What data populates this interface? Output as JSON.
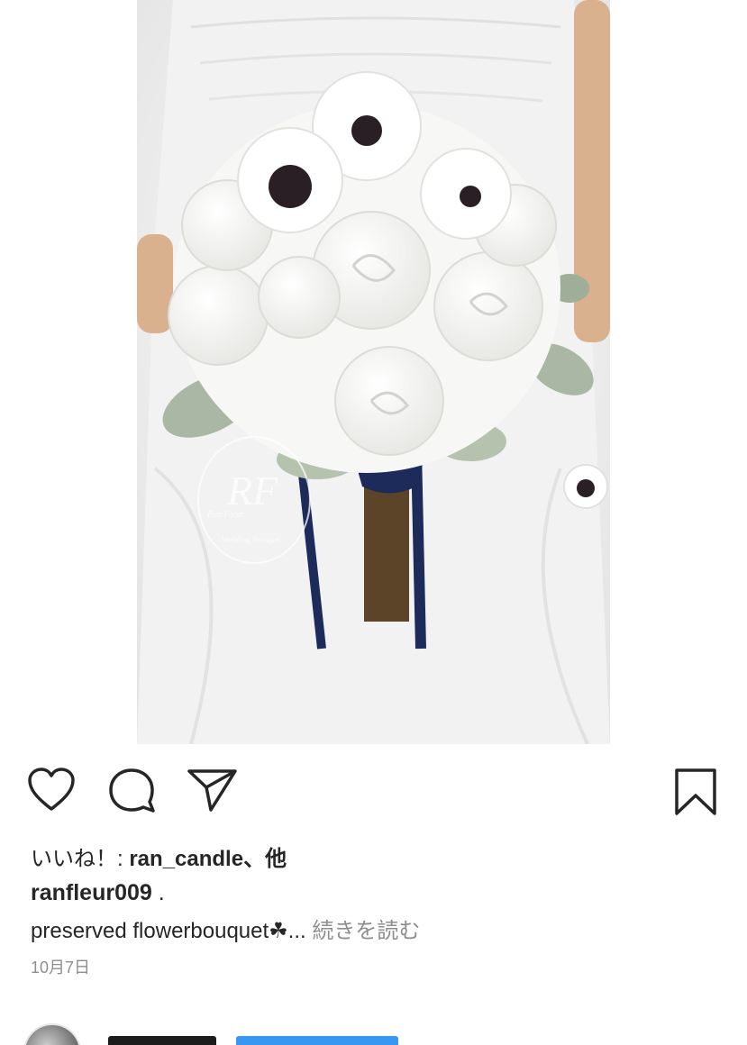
{
  "post": {
    "image_alt": "",
    "watermark_monogram": "RF",
    "watermark_brand": "Ran Fleur",
    "watermark_tagline": "Wedding Bouquet"
  },
  "actions": {
    "like_icon": "heart-outline-icon",
    "comment_icon": "speech-bubble-icon",
    "share_icon": "paper-plane-icon",
    "bookmark_icon": "bookmark-outline-icon"
  },
  "likes": {
    "prefix": "いいね！: ",
    "user": "ran_candle",
    "suffix": "、他"
  },
  "caption": {
    "username": "ranfleur009",
    "dot": " .",
    "text": "preserved flowerbouquet☘︎...",
    "more_label": " 続きを読む"
  },
  "date": "10月7日",
  "colors": {
    "text": "#262626",
    "muted": "#8e8e8e",
    "link": "#3897f0"
  }
}
